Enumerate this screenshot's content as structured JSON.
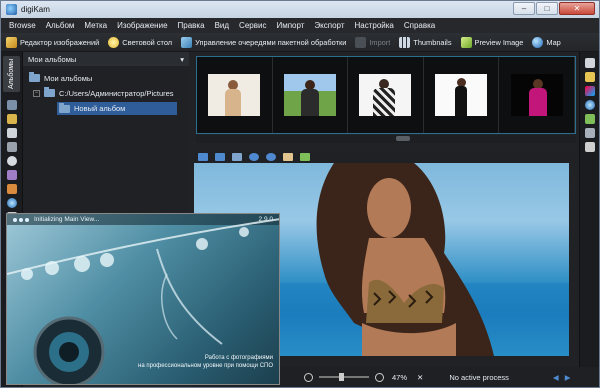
{
  "window": {
    "title": "digiKam",
    "minimize": "–",
    "maximize": "□",
    "close": "✕"
  },
  "menu": [
    "Browse",
    "Альбом",
    "Метка",
    "Изображение",
    "Правка",
    "Вид",
    "Сервис",
    "Импорт",
    "Экспорт",
    "Настройка",
    "Справка"
  ],
  "toolbar": {
    "editor": "Редактор изображений",
    "lighttable": "Световой стол",
    "batch": "Управление очередями пакетной обработки",
    "import": "Import",
    "thumbnails": "Thumbnails",
    "preview": "Preview Image",
    "map": "Map"
  },
  "left_tab": {
    "label": "Альбомы"
  },
  "tree": {
    "header": "Мои альбомы",
    "root": "Мои альбомы",
    "path": "C:/Users/Администратор/Pictures",
    "album": "Новый альбом",
    "expand_symbol": "−"
  },
  "preview": {
    "zoom": "47%",
    "status": "No active process",
    "close": "✕"
  },
  "splash": {
    "message": "Initializing Main View...",
    "version": "2.9.0",
    "tagline_1": "Работа с фотографиями",
    "tagline_2": "на профессиональном уровне при помощи СПО"
  },
  "colors": {
    "accent": "#2f5d9a",
    "toolbar_bg": "#2c2f33",
    "window_bg": "#202225"
  },
  "icons": [
    "editor-icon",
    "lighttable-icon",
    "batch-queue-icon",
    "import-icon",
    "thumbnails-icon",
    "preview-icon",
    "map-icon"
  ]
}
